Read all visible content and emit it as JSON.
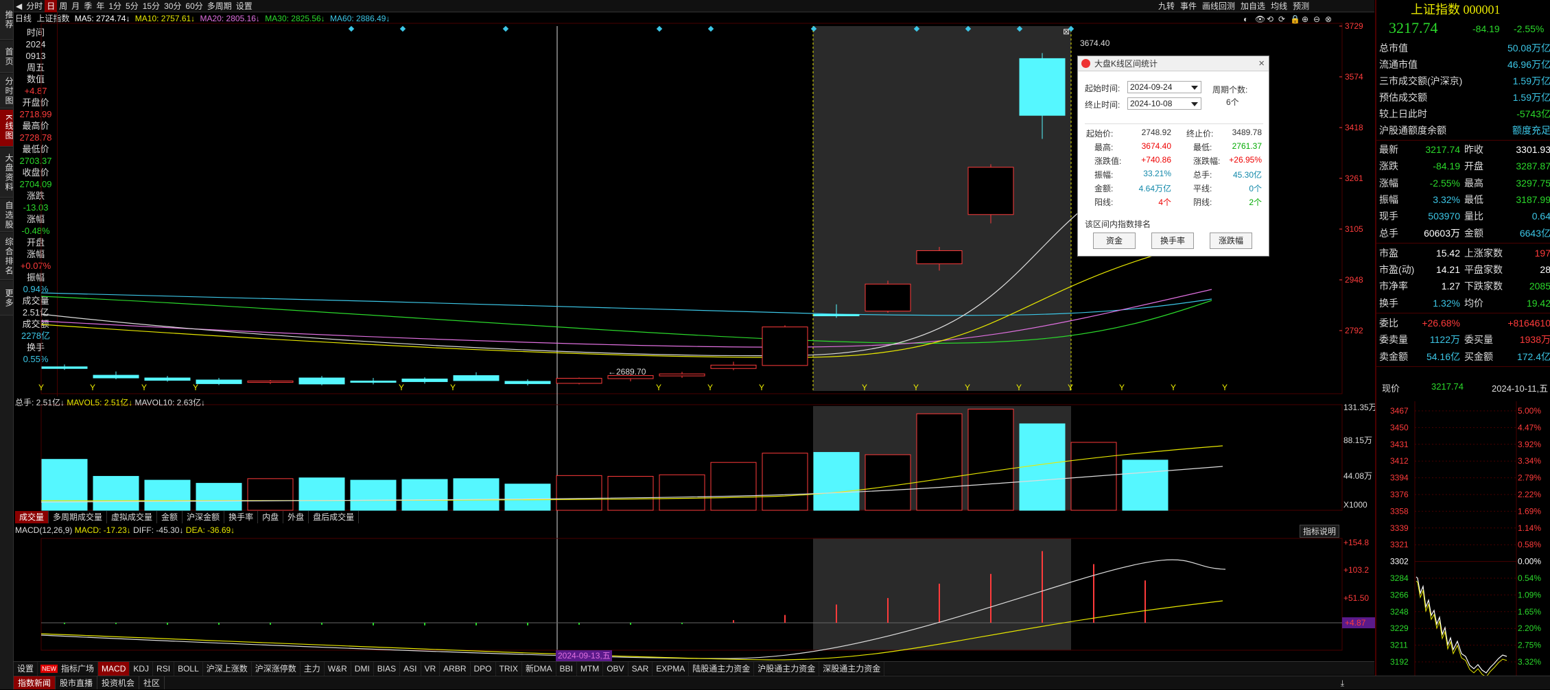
{
  "left_nav": [
    "推荐",
    "首页",
    "分时图",
    "K线图",
    "大盘资料",
    "自选股",
    "综合排名",
    "更多"
  ],
  "toolbar": {
    "items": [
      "◀",
      "分时",
      "日",
      "周",
      "月",
      "季",
      "年",
      "1分",
      "5分",
      "15分",
      "30分",
      "60分",
      "多周期",
      "设置"
    ],
    "active_index": 2,
    "right_items": [
      "九转",
      "事件",
      "画线回测",
      "加自选",
      "均线",
      "预测"
    ]
  },
  "legend": {
    "period": "日线",
    "name": "上证指数",
    "ma5": "MA5: 2724.74↓",
    "ma10": "MA10: 2757.61↓",
    "ma20": "MA20: 2805.16↓",
    "ma30": "MA30: 2825.56↓",
    "ma60": "MA60: 2886.49↓"
  },
  "info_panel": [
    {
      "label": "时间",
      "cls": "ipl"
    },
    {
      "label": "2024",
      "cls": "ipl"
    },
    {
      "label": "0913",
      "cls": "ipl"
    },
    {
      "label": "周五",
      "cls": "ipl"
    },
    {
      "label": "数值",
      "cls": "ipl"
    },
    {
      "label": "+4.87",
      "cls": "ipr"
    },
    {
      "label": "开盘价",
      "cls": "ipl"
    },
    {
      "label": "2718.99",
      "cls": "ipr"
    },
    {
      "label": "最高价",
      "cls": "ipl"
    },
    {
      "label": "2728.78",
      "cls": "ipr"
    },
    {
      "label": "最低价",
      "cls": "ipl"
    },
    {
      "label": "2703.37",
      "cls": "ipg"
    },
    {
      "label": "收盘价",
      "cls": "ipl"
    },
    {
      "label": "2704.09",
      "cls": "ipg"
    },
    {
      "label": "涨跌",
      "cls": "ipl"
    },
    {
      "label": "-13.03",
      "cls": "ipg"
    },
    {
      "label": "涨幅",
      "cls": "ipl"
    },
    {
      "label": "-0.48%",
      "cls": "ipg"
    },
    {
      "label": "开盘",
      "cls": "ipl"
    },
    {
      "label": "涨幅",
      "cls": "ipl"
    },
    {
      "label": "+0.07%",
      "cls": "ipr"
    },
    {
      "label": "振幅",
      "cls": "ipl"
    },
    {
      "label": "0.94%",
      "cls": "ipc"
    },
    {
      "label": "成交量",
      "cls": "ipl"
    },
    {
      "label": "2.51亿",
      "cls": "ipl"
    },
    {
      "label": "成交额",
      "cls": "ipl"
    },
    {
      "label": "2278亿",
      "cls": "ipc"
    },
    {
      "label": "换手",
      "cls": "ipl"
    },
    {
      "label": "0.55%",
      "cls": "ipc"
    }
  ],
  "price_axis": [
    "3729",
    "3574",
    "3418",
    "3261",
    "3105",
    "2948",
    "2792"
  ],
  "low_label": "←2689.70",
  "high_label": "3674.40",
  "date_label": "2024-09-13,五",
  "volume": {
    "legend_total": "总手: 2.51亿↓",
    "legend_ma5": "MAVOL5: 2.51亿↓",
    "legend_ma10": "MAVOL10: 2.63亿↓",
    "axis": [
      "131.35万",
      "88.15万",
      "44.08万",
      "X1000"
    ],
    "tabs": [
      "成交量",
      "多周期成交量",
      "虚拟成交量",
      "金额",
      "沪深金额",
      "换手率",
      "内盘",
      "外盘",
      "盘后成交量"
    ]
  },
  "macd": {
    "legend_title": "MACD(12,26,9)",
    "legend_macd": "MACD: -17.23↓",
    "legend_diff": "DIFF: -45.30↓",
    "legend_dea": "DEA: -36.69↓",
    "axis": [
      "+154.8",
      "+103.2",
      "+51.50"
    ],
    "current": "+4.87",
    "help": "指标说明"
  },
  "indicators": [
    "设置",
    "指标广场",
    "MACD",
    "KDJ",
    "RSI",
    "BOLL",
    "沪深上涨数",
    "沪深涨停数",
    "主力",
    "W&R",
    "DMI",
    "BIAS",
    "ASI",
    "VR",
    "ARBR",
    "DPO",
    "TRIX",
    "新DMA",
    "BBI",
    "MTM",
    "OBV",
    "SAR",
    "EXPMA",
    "陆股通主力资金",
    "沪股通主力资金",
    "深股通主力资金"
  ],
  "indicators_badge": "NEW",
  "bottom_tabs": [
    "指数新闻",
    "股市直播",
    "投资机会",
    "社区"
  ],
  "popup": {
    "title": "大盘K线区间统计",
    "start_label": "起始时间:",
    "start_value": "2024-09-24",
    "end_label": "终止时间:",
    "end_value": "2024-10-08",
    "period_label": "周期个数:",
    "period_value": "6个",
    "stats": [
      {
        "label": "起始价:",
        "value": "2748.92",
        "cls": "#333",
        "label2": "终止价:",
        "value2": "3489.78",
        "cls2": "#333"
      },
      {
        "label": "最高:",
        "value": "3674.40",
        "cls": "#e00",
        "label2": "最低:",
        "value2": "2761.37",
        "cls2": "#0a0"
      },
      {
        "label": "涨跌值:",
        "value": "+740.86",
        "cls": "#e00",
        "label2": "涨跌幅:",
        "value2": "+26.95%",
        "cls2": "#e00"
      },
      {
        "label": "振幅:",
        "value": "33.21%",
        "cls": "#18a",
        "label2": "总手:",
        "value2": "45.30亿",
        "cls2": "#18a"
      },
      {
        "label": "金额:",
        "value": "4.64万亿",
        "cls": "#18a",
        "label2": "平线:",
        "value2": "0个",
        "cls2": "#18a"
      },
      {
        "label": "阳线:",
        "value": "4个",
        "cls": "#e00",
        "label2": "阴线:",
        "value2": "2个",
        "cls2": "#0a0"
      }
    ],
    "rank_title": "该区间内指数排名",
    "buttons": [
      "资金",
      "换手率",
      "涨跌幅"
    ]
  },
  "right_panel": {
    "title": "上证指数 000001",
    "price": "3217.74",
    "change": "-84.19",
    "pct": "-2.55%",
    "rows1": [
      {
        "l": "总市值",
        "v": "50.08万亿",
        "c": "cyan"
      },
      {
        "l": "流通市值",
        "v": "46.96万亿",
        "c": "cyan"
      },
      {
        "l": "三市成交额(沪深京)",
        "v": "1.59万亿",
        "c": "cyan"
      },
      {
        "l": "预估成交额",
        "v": "1.59万亿",
        "c": "cyan"
      },
      {
        "l": "较上日此时",
        "v": "-5743亿",
        "c": "green"
      },
      {
        "l": "沪股通额度余额",
        "v": "额度充足",
        "c": "cyan"
      }
    ],
    "rows2": [
      {
        "l": "最新",
        "v": "3217.74",
        "c": "green",
        "l2": "昨收",
        "v2": "3301.93",
        "c2": "white"
      },
      {
        "l": "涨跌",
        "v": "-84.19",
        "c": "green",
        "l2": "开盘",
        "v2": "3287.87",
        "c2": "green"
      },
      {
        "l": "涨幅",
        "v": "-2.55%",
        "c": "green",
        "l2": "最高",
        "v2": "3297.75",
        "c2": "green"
      },
      {
        "l": "振幅",
        "v": "3.32%",
        "c": "cyan",
        "l2": "最低",
        "v2": "3187.99",
        "c2": "green"
      },
      {
        "l": "现手",
        "v": "503970",
        "c": "cyan",
        "l2": "量比",
        "v2": "0.64",
        "c2": "cyan"
      },
      {
        "l": "总手",
        "v": "60603万",
        "c": "white",
        "l2": "金额",
        "v2": "6643亿",
        "c2": "cyan"
      }
    ],
    "rows3": [
      {
        "l": "市盈",
        "v": "15.42",
        "c": "white",
        "l2": "上涨家数",
        "v2": "197",
        "c2": "red"
      },
      {
        "l": "市盈(动)",
        "v": "14.21",
        "c": "white",
        "l2": "平盘家数",
        "v2": "28",
        "c2": "white"
      },
      {
        "l": "市净率",
        "v": "1.27",
        "c": "white",
        "l2": "下跌家数",
        "v2": "2085",
        "c2": "green"
      },
      {
        "l": "换手",
        "v": "1.32%",
        "c": "cyan",
        "l2": "均价",
        "v2": "19.42",
        "c2": "green"
      }
    ],
    "rows4": [
      {
        "l": "委比",
        "v": "+26.68%",
        "c": "red",
        "l2": "",
        "v2": "+8164610",
        "c2": "red"
      },
      {
        "l": "委卖量",
        "v": "1122万",
        "c": "cyan",
        "l2": "委买量",
        "v2": "1938万",
        "c2": "red"
      },
      {
        "l": "卖金额",
        "v": "54.16亿",
        "c": "cyan",
        "l2": "买金额",
        "v2": "172.4亿",
        "c2": "cyan"
      }
    ],
    "now_label": "现价",
    "now_value": "3217.74",
    "now_date": "2024-10-11,五",
    "mini_axis_left": [
      "3467",
      "3450",
      "3431",
      "3412",
      "3394",
      "3376",
      "3358",
      "3339",
      "3321",
      "3302",
      "3284",
      "3266",
      "3248",
      "3229",
      "3211",
      "3192"
    ],
    "mini_axis_right": [
      "5.00%",
      "4.47%",
      "3.92%",
      "3.34%",
      "2.79%",
      "2.22%",
      "1.69%",
      "1.14%",
      "0.58%",
      "0.00%",
      "0.54%",
      "1.09%",
      "1.65%",
      "2.20%",
      "2.75%",
      "3.32%"
    ]
  },
  "chart_data": {
    "type": "candlestick",
    "ylim": [
      2689.7,
      3729
    ],
    "candles": [
      {
        "o": 2745,
        "h": 2752,
        "l": 2736,
        "c": 2740
      },
      {
        "o": 2720,
        "h": 2731,
        "l": 2708,
        "c": 2712
      },
      {
        "o": 2712,
        "h": 2718,
        "l": 2701,
        "c": 2705
      },
      {
        "o": 2706,
        "h": 2712,
        "l": 2691,
        "c": 2695
      },
      {
        "o": 2700,
        "h": 2706,
        "l": 2694,
        "c": 2703
      },
      {
        "o": 2712,
        "h": 2718,
        "l": 2690,
        "c": 2694
      },
      {
        "o": 2703,
        "h": 2712,
        "l": 2693,
        "c": 2700
      },
      {
        "o": 2709,
        "h": 2714,
        "l": 2695,
        "c": 2701
      },
      {
        "o": 2718.99,
        "h": 2728.78,
        "l": 2703.37,
        "c": 2704.09
      },
      {
        "o": 2702,
        "h": 2708,
        "l": 2689.7,
        "c": 2695
      },
      {
        "o": 2696,
        "h": 2713,
        "l": 2693,
        "c": 2711
      },
      {
        "o": 2710,
        "h": 2725,
        "l": 2702,
        "c": 2719
      },
      {
        "o": 2718,
        "h": 2730,
        "l": 2712,
        "c": 2724
      },
      {
        "o": 2740,
        "h": 2760,
        "l": 2735,
        "c": 2750
      },
      {
        "o": 2748.92,
        "h": 2868,
        "l": 2761.37,
        "c": 2863
      },
      {
        "o": 2900,
        "h": 2930,
        "l": 2890,
        "c": 2897
      },
      {
        "o": 2910,
        "h": 3000,
        "l": 2905,
        "c": 2990
      },
      {
        "o": 3050,
        "h": 3100,
        "l": 3030,
        "c": 3089
      },
      {
        "o": 3196,
        "h": 3345,
        "l": 3170,
        "c": 3336
      },
      {
        "o": 3658,
        "h": 3674.4,
        "l": 3420,
        "c": 3489.78
      }
    ],
    "volumes": [
      66,
      44,
      39,
      35,
      41,
      42,
      39,
      40,
      41,
      34,
      45,
      44,
      46,
      62,
      74,
      75,
      72,
      125,
      131,
      112,
      88,
      65
    ]
  }
}
